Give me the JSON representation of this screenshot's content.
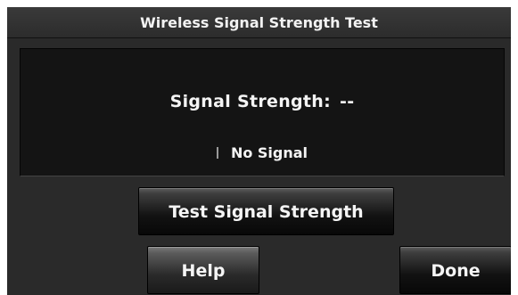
{
  "title": "Wireless Signal Strength Test",
  "signal": {
    "strength_label": "Signal Strength:",
    "strength_value": "--",
    "status": "No Signal"
  },
  "buttons": {
    "test": "Test Signal Strength",
    "help": "Help",
    "done": "Done"
  },
  "icons": {
    "signal_bars": "signal-bars-icon"
  }
}
